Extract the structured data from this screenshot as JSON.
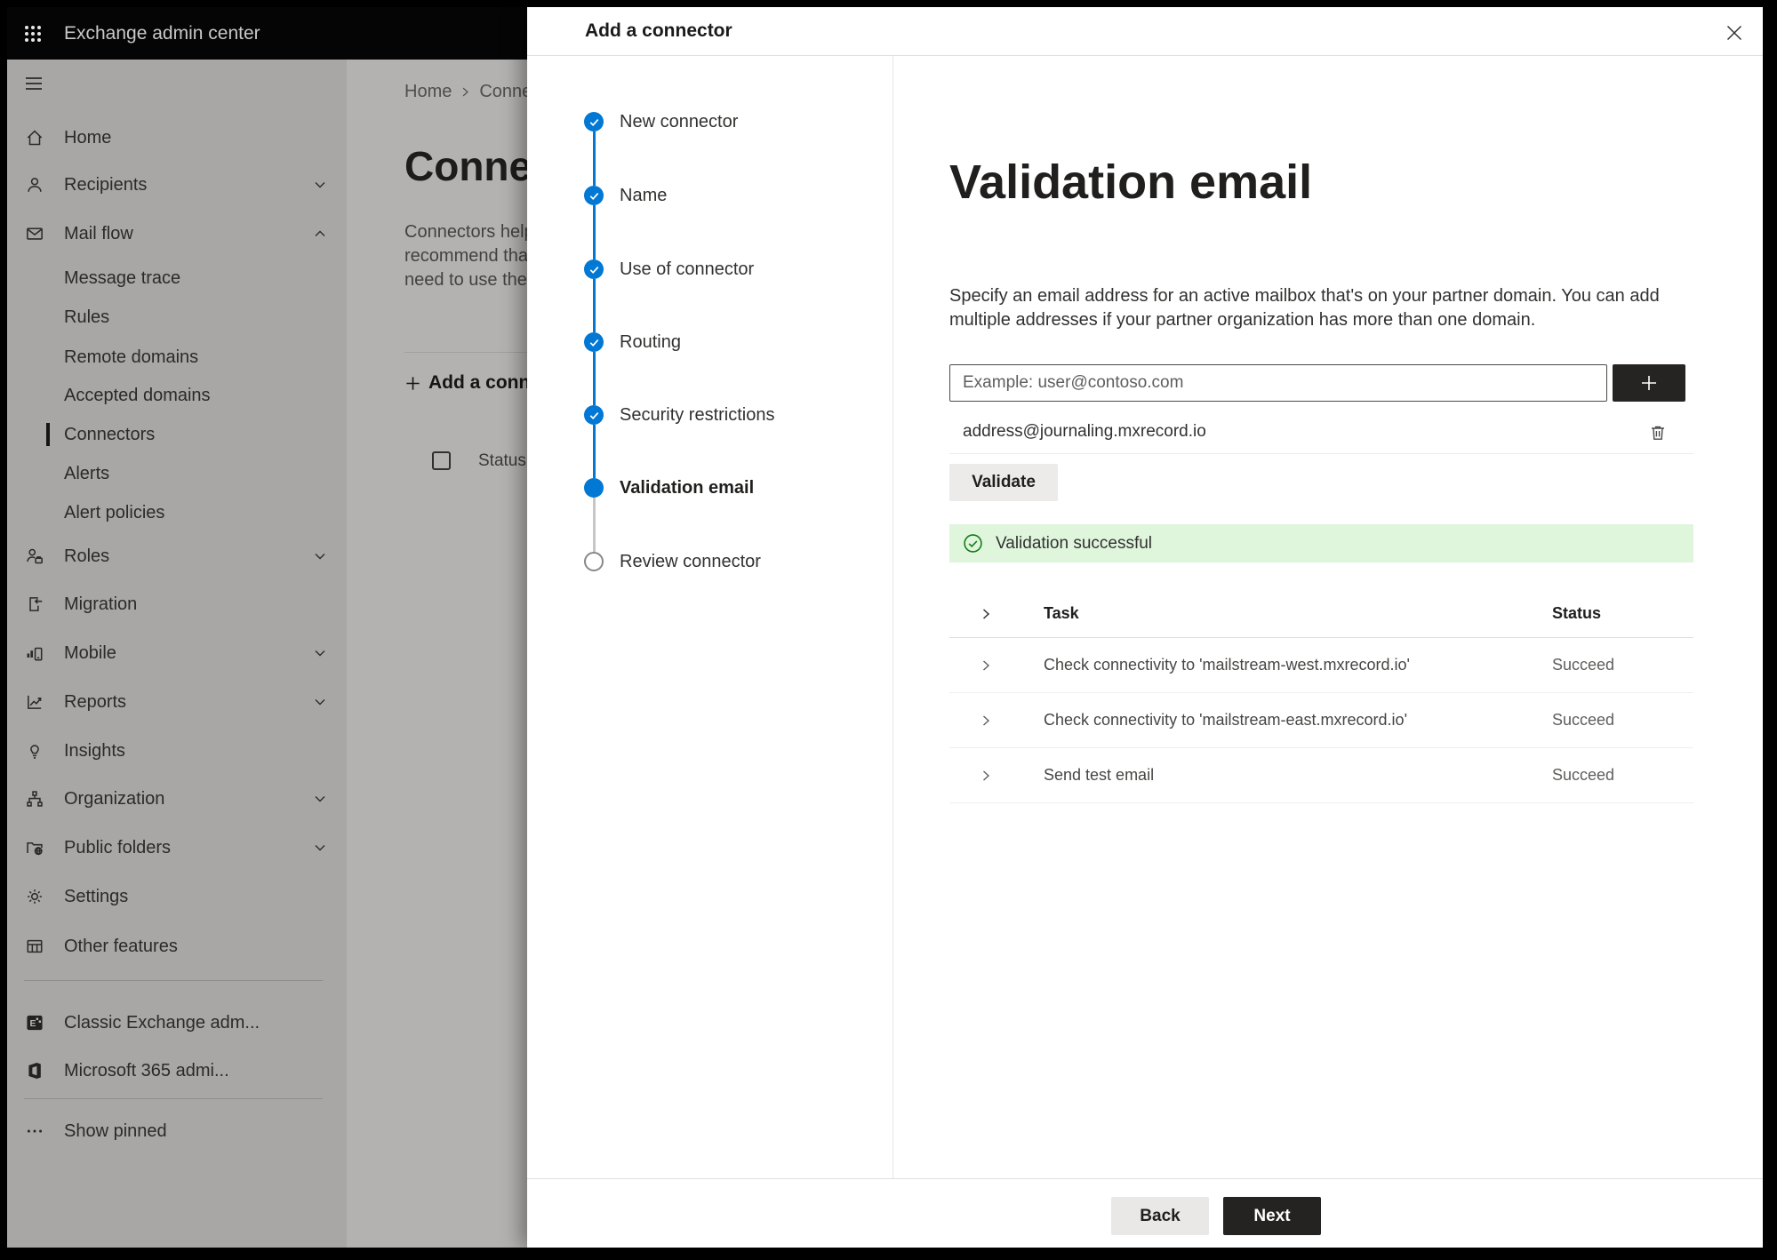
{
  "colors": {
    "accent_blue": "#0078d4",
    "success_green": "#107c10",
    "banner_bg": "#dff6dd",
    "topbar_bg": "#000000"
  },
  "topbar": {
    "app_title": "Exchange admin center"
  },
  "background_page": {
    "breadcrumb": {
      "home": "Home",
      "current": "Conne"
    },
    "heading": "Connec",
    "intro_lines": [
      "Connectors help",
      "recommend that",
      "need to use ther"
    ],
    "add_connector_label": "Add a conn",
    "table_status_header": "Status"
  },
  "sidebar": {
    "items": [
      {
        "label": "Home"
      },
      {
        "label": "Recipients"
      },
      {
        "label": "Mail flow"
      },
      {
        "label": "Message trace"
      },
      {
        "label": "Rules"
      },
      {
        "label": "Remote domains"
      },
      {
        "label": "Accepted domains"
      },
      {
        "label": "Connectors"
      },
      {
        "label": "Alerts"
      },
      {
        "label": "Alert policies"
      },
      {
        "label": "Roles"
      },
      {
        "label": "Migration"
      },
      {
        "label": "Mobile"
      },
      {
        "label": "Reports"
      },
      {
        "label": "Insights"
      },
      {
        "label": "Organization"
      },
      {
        "label": "Public folders"
      },
      {
        "label": "Settings"
      },
      {
        "label": "Other features"
      },
      {
        "label": "Classic Exchange adm..."
      },
      {
        "label": "Microsoft 365 admi..."
      },
      {
        "label": "Show pinned"
      }
    ]
  },
  "panel": {
    "title": "Add a connector",
    "steps": [
      {
        "label": "New connector",
        "state": "done"
      },
      {
        "label": "Name",
        "state": "done"
      },
      {
        "label": "Use of connector",
        "state": "done"
      },
      {
        "label": "Routing",
        "state": "done"
      },
      {
        "label": "Security restrictions",
        "state": "done"
      },
      {
        "label": "Validation email",
        "state": "current"
      },
      {
        "label": "Review connector",
        "state": "upcoming"
      }
    ],
    "content": {
      "title": "Validation email",
      "description": "Specify an email address for an active mailbox that's on your partner domain. You can add multiple addresses if your partner organization has more than one domain.",
      "email_placeholder": "Example: user@contoso.com",
      "addresses": [
        {
          "email": "address@journaling.mxrecord.io"
        }
      ],
      "validate_label": "Validate",
      "banner_text": "Validation successful",
      "table": {
        "task_header": "Task",
        "status_header": "Status",
        "rows": [
          {
            "task": "Check connectivity to 'mailstream-west.mxrecord.io'",
            "status": "Succeed"
          },
          {
            "task": "Check connectivity to 'mailstream-east.mxrecord.io'",
            "status": "Succeed"
          },
          {
            "task": "Send test email",
            "status": "Succeed"
          }
        ]
      }
    },
    "footer": {
      "back_label": "Back",
      "next_label": "Next"
    }
  }
}
